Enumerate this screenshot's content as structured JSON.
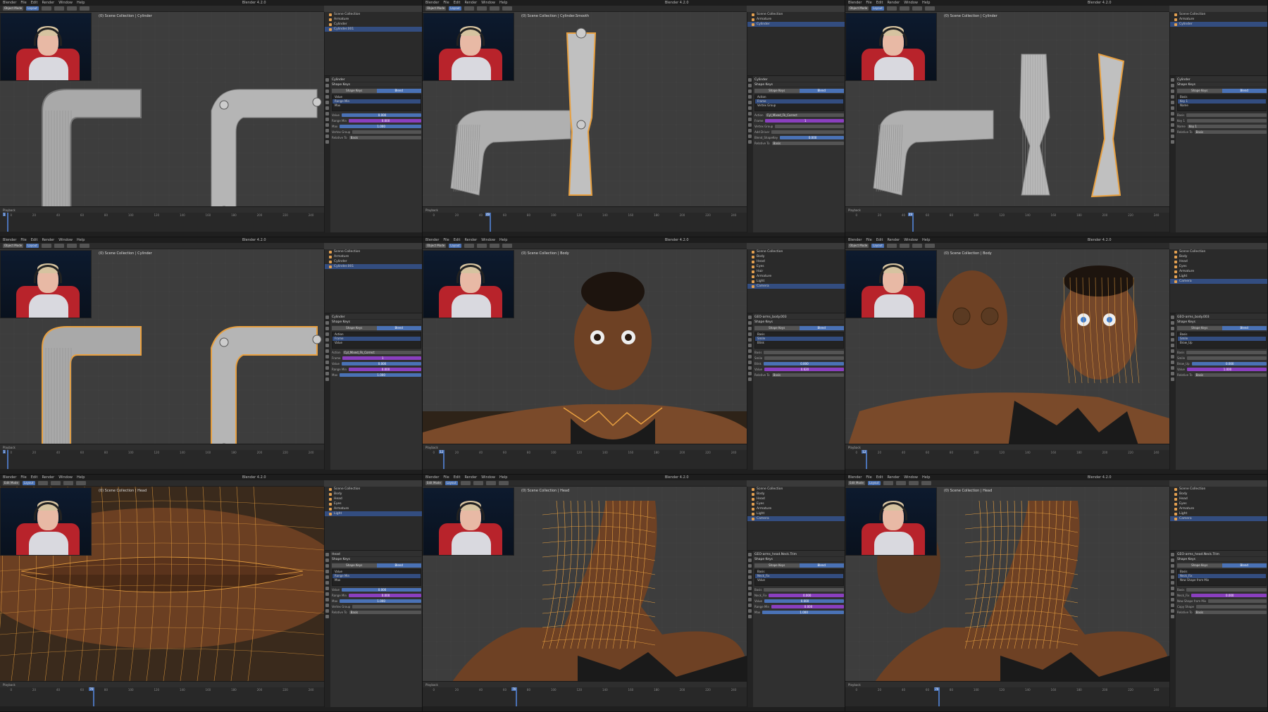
{
  "app": {
    "menu": [
      "Blender",
      "File",
      "Edit",
      "Render",
      "Window",
      "Help"
    ],
    "workspace_tab": "Layout",
    "version": "4.2.0"
  },
  "colors": {
    "selection": "#e8a040",
    "active_blue": "#4a72b6",
    "purple": "#8a3fbf"
  },
  "tiles": [
    {
      "title": "Blender 4.2.0",
      "mode": "Object Mode",
      "collection": "(0) Scene Collection | Cylinder",
      "outliner": [
        "Scene Collection",
        "Armature",
        "Cylinder",
        "Cylinder.001"
      ],
      "props_header": "Cylinder",
      "props": {
        "section": "Shape Keys",
        "tabs": [
          "Shape Keys",
          "Blend"
        ],
        "fields": [
          [
            "Value",
            "0.000"
          ],
          [
            "Range Min",
            "0.000"
          ],
          [
            "Max",
            "1.000"
          ],
          [
            "Vertex Group",
            ""
          ],
          [
            "Relative To",
            "Basis"
          ]
        ]
      },
      "timeline": {
        "label": "Playback",
        "frame": "1"
      }
    },
    {
      "title": "Blender 4.2.0",
      "mode": "Object Mode",
      "collection": "(0) Scene Collection | Cylinder.Smooth",
      "outliner": [
        "Scene Collection",
        "Armature",
        "Cylinder"
      ],
      "props_header": "Cylinder",
      "props": {
        "section": "Shape Keys",
        "tabs": [
          "Shape Keys",
          "Blend"
        ],
        "fields": [
          [
            "Action",
            "Cyl_Mixed_Fk_Correct"
          ],
          [
            "Frame",
            "1"
          ],
          [
            "Vertex Group",
            ""
          ],
          [
            "Add Driver",
            ""
          ],
          [
            "Blend_ShapeKey",
            "0.000"
          ],
          [
            "Relative To",
            "Basis"
          ]
        ]
      },
      "timeline": {
        "label": "Playback",
        "frame": "49"
      }
    },
    {
      "title": "Blender 4.2.0",
      "mode": "Object Mode",
      "collection": "(0) Scene Collection | Cylinder",
      "outliner": [
        "Scene Collection",
        "Armature",
        "Cylinder"
      ],
      "props_header": "Cylinder",
      "props": {
        "section": "Shape Keys",
        "tabs": [
          "Shape Keys",
          "Blend"
        ],
        "fields": [
          [
            "Basis",
            ""
          ],
          [
            "Key 1",
            ""
          ],
          [
            "Name",
            "Key 1"
          ],
          [
            "Relative To",
            "Basis"
          ]
        ]
      },
      "timeline": {
        "label": "Playback",
        "frame": "49"
      }
    },
    {
      "title": "Blender 4.2.0",
      "mode": "Object Mode",
      "collection": "(0) Scene Collection | Cylinder",
      "outliner": [
        "Scene Collection",
        "Armature",
        "Cylinder",
        "Cylinder.001"
      ],
      "props_header": "Cylinder",
      "props": {
        "section": "Shape Keys",
        "tabs": [
          "Shape Keys",
          "Blend"
        ],
        "fields": [
          [
            "Action",
            "Cyl_Mixed_Fk_Correct"
          ],
          [
            "Frame",
            "1"
          ],
          [
            "Value",
            "0.000"
          ],
          [
            "Range Min",
            "0.000"
          ],
          [
            "Max",
            "1.000"
          ]
        ]
      },
      "timeline": {
        "label": "Playback",
        "frame": "1"
      }
    },
    {
      "title": "Blender 4.2.0",
      "mode": "Object Mode",
      "collection": "(0) Scene Collection | Body",
      "outliner": [
        "Scene Collection",
        "Body",
        "Head",
        "Eyes",
        "Hair",
        "Armature",
        "Light",
        "Camera"
      ],
      "props_header": "GEO-arms_body.003",
      "props": {
        "section": "Shape Keys",
        "tabs": [
          "Shape Keys",
          "Blend"
        ],
        "fields": [
          [
            "Basis",
            ""
          ],
          [
            "Smile",
            ""
          ],
          [
            "Blink",
            "0.000"
          ],
          [
            "Value",
            "0.620"
          ],
          [
            "Relative To",
            "Basis"
          ]
        ]
      },
      "timeline": {
        "label": "Playback",
        "frame": "12"
      }
    },
    {
      "title": "Blender 4.2.0",
      "mode": "Object Mode",
      "collection": "(0) Scene Collection | Body",
      "outliner": [
        "Scene Collection",
        "Body",
        "Head",
        "Eyes",
        "Armature",
        "Light",
        "Camera"
      ],
      "props_header": "GEO-arms_body.003",
      "props": {
        "section": "Shape Keys",
        "tabs": [
          "Shape Keys",
          "Blend"
        ],
        "fields": [
          [
            "Basis",
            ""
          ],
          [
            "Smile",
            ""
          ],
          [
            "Brow_Up",
            "0.000"
          ],
          [
            "Value",
            "1.000"
          ],
          [
            "Relative To",
            "Basis"
          ]
        ]
      },
      "timeline": {
        "label": "Playback",
        "frame": "12"
      }
    },
    {
      "title": "Blender 4.2.0",
      "mode": "Edit Mode",
      "collection": "(0) Scene Collection | Head",
      "outliner": [
        "Scene Collection",
        "Body",
        "Head",
        "Eyes",
        "Armature",
        "Light"
      ],
      "props_header": "Head",
      "props": {
        "section": "Shape Keys",
        "tabs": [
          "Shape Keys",
          "Blend"
        ],
        "fields": [
          [
            "Value",
            "0.000"
          ],
          [
            "Range Min",
            "0.000"
          ],
          [
            "Max",
            "1.000"
          ],
          [
            "Vertex Group",
            ""
          ],
          [
            "Relative To",
            "Basis"
          ]
        ]
      },
      "timeline": {
        "label": "Playback",
        "frame": "70"
      }
    },
    {
      "title": "Blender 4.2.0",
      "mode": "Edit Mode",
      "collection": "(0) Scene Collection | Head",
      "outliner": [
        "Scene Collection",
        "Body",
        "Head",
        "Eyes",
        "Armature",
        "Light",
        "Camera"
      ],
      "props_header": "GEO-arms_head.Neck.Trim",
      "props": {
        "section": "Shape Keys",
        "tabs": [
          "Shape Keys",
          "Blend"
        ],
        "fields": [
          [
            "Basis",
            ""
          ],
          [
            "Neck_Fix",
            "0.000"
          ],
          [
            "Value",
            "0.000"
          ],
          [
            "Range Min",
            "0.000"
          ],
          [
            "Max",
            "1.000"
          ]
        ]
      },
      "timeline": {
        "label": "Playback",
        "frame": "70"
      }
    },
    {
      "title": "Blender 4.2.0",
      "mode": "Edit Mode",
      "collection": "(0) Scene Collection | Head",
      "outliner": [
        "Scene Collection",
        "Body",
        "Head",
        "Eyes",
        "Armature",
        "Light",
        "Camera"
      ],
      "props_header": "GEO-arms_head.Neck.Trim",
      "props": {
        "section": "Shape Keys",
        "tabs": [
          "Shape Keys",
          "Blend"
        ],
        "fields": [
          [
            "Basis",
            ""
          ],
          [
            "Neck_Fix",
            "0.000"
          ],
          [
            "New Shape from Mix",
            ""
          ],
          [
            "Copy Shape",
            ""
          ],
          [
            "Relative To",
            "Basis"
          ]
        ]
      },
      "timeline": {
        "label": "Playback",
        "frame": "70"
      }
    }
  ]
}
